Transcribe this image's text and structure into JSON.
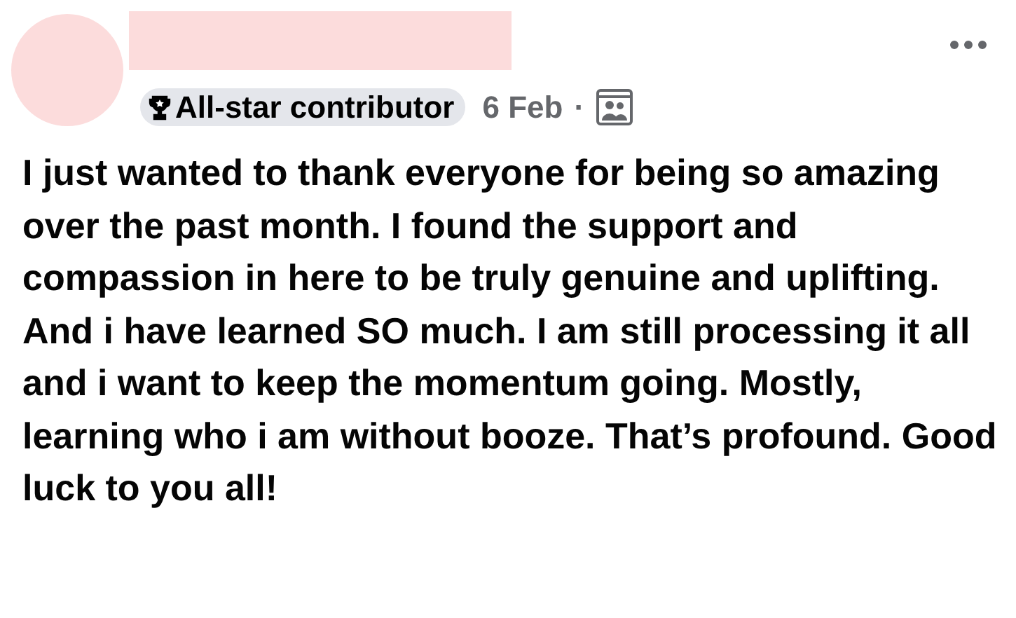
{
  "post": {
    "badge": "All-star contributor",
    "date": "6 Feb",
    "separator": "·",
    "body": "I just wanted to thank everyone for being so amazing over the past month. I found the support and compassion in here to be truly genuine and uplifting. And i have learned SO much. I am still processing it all and i want to keep the momentum going. Mostly, learning who i am without booze. That’s profound. Good luck to you all!"
  }
}
